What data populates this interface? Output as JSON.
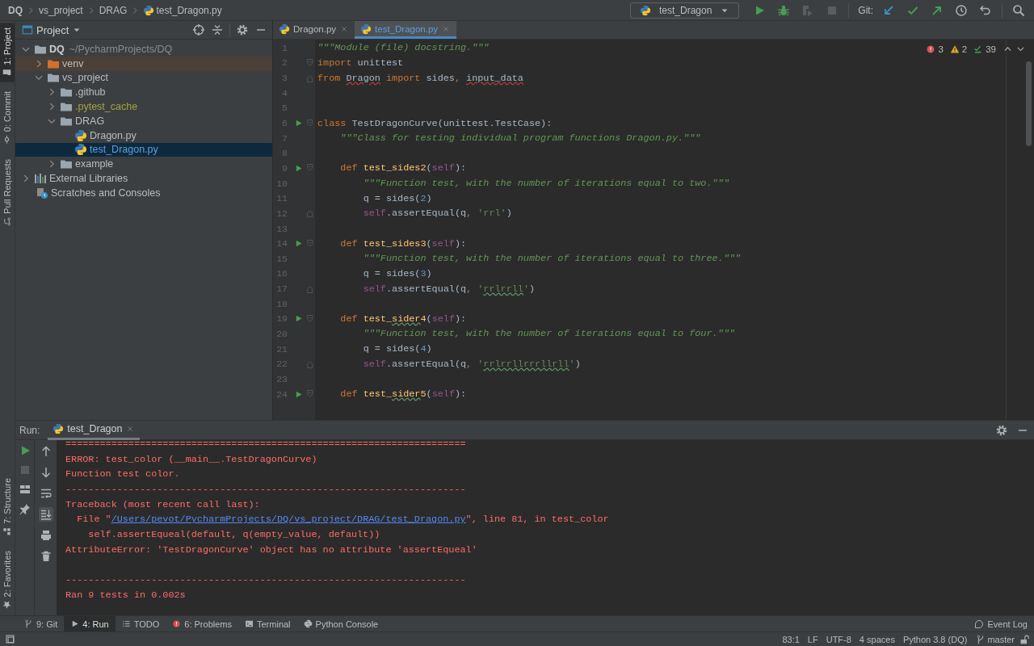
{
  "breadcrumbs": [
    {
      "label": "DQ",
      "kind": "root"
    },
    {
      "label": "vs_project",
      "kind": "folder"
    },
    {
      "label": "DRAG",
      "kind": "folder"
    },
    {
      "label": "test_Dragon.py",
      "kind": "python-file"
    }
  ],
  "toolbar": {
    "run_config": "test_Dragon",
    "actions": [
      {
        "kind": "run",
        "disabled": false
      },
      {
        "kind": "debug",
        "disabled": false
      },
      {
        "kind": "coverage",
        "disabled": true
      },
      {
        "kind": "stop",
        "disabled": true
      }
    ],
    "git_label": "Git:",
    "git_actions": [
      {
        "kind": "update"
      },
      {
        "kind": "commit"
      },
      {
        "kind": "push"
      },
      {
        "kind": "history"
      },
      {
        "kind": "rollback"
      }
    ]
  },
  "left_stripe": {
    "top": [
      {
        "label": "1: Project",
        "kind": "project",
        "selected": true
      },
      {
        "label": "0: Commit",
        "kind": "commit",
        "selected": false
      },
      {
        "label": "Pull Requests",
        "kind": "pull-request",
        "selected": false
      }
    ],
    "bottom": [
      {
        "label": "7: Structure",
        "kind": "structure",
        "selected": false
      },
      {
        "label": "2: Favorites",
        "kind": "favorites",
        "selected": false
      }
    ]
  },
  "project_panel": {
    "title": "Project",
    "tree": [
      {
        "label": "DQ",
        "detail": "~/PycharmProjects/DQ",
        "kind": "root",
        "expanded": true,
        "selected": false,
        "children": [
          {
            "label": "venv",
            "kind": "excluded-folder",
            "expanded": false,
            "selected": false
          },
          {
            "label": "vs_project",
            "kind": "folder",
            "expanded": true,
            "selected": false,
            "children": [
              {
                "label": ".github",
                "kind": "folder",
                "expanded": false,
                "selected": false
              },
              {
                "label": ".pytest_cache",
                "kind": "ignored-folder",
                "expanded": false,
                "selected": false
              },
              {
                "label": "DRAG",
                "kind": "folder",
                "expanded": true,
                "selected": false,
                "children": [
                  {
                    "label": "Dragon.py",
                    "kind": "python-file",
                    "selected": false
                  },
                  {
                    "label": "test_Dragon.py",
                    "kind": "python-file",
                    "selected": true
                  }
                ]
              },
              {
                "label": "example",
                "kind": "folder",
                "expanded": false,
                "selected": false
              }
            ]
          }
        ]
      },
      {
        "label": "External Libraries",
        "kind": "libraries",
        "expanded": false,
        "selected": false
      },
      {
        "label": "Scratches and Consoles",
        "kind": "scratches",
        "selected": false
      }
    ]
  },
  "editor": {
    "tabs": [
      {
        "label": "Dragon.py",
        "selected": false
      },
      {
        "label": "test_Dragon.py",
        "selected": true
      }
    ],
    "inspections": {
      "errors": "3",
      "warnings": "2",
      "passed": "39"
    },
    "lines": [
      {
        "number": "1",
        "tokens": [
          {
            "kind": "doc",
            "text": "\"\"\"Module (file) docstring.\"\"\""
          }
        ]
      },
      {
        "number": "2",
        "fold_start": true,
        "tokens": [
          {
            "kind": "kw",
            "text": "import"
          },
          {
            "kind": "plain",
            "text": " unittest"
          }
        ]
      },
      {
        "number": "3",
        "fold_end": true,
        "tokens": [
          {
            "kind": "kw",
            "text": "from "
          },
          {
            "kind": "plain",
            "text": "Dragon",
            "error": true
          },
          {
            "kind": "kw",
            "text": " import"
          },
          {
            "kind": "plain",
            "text": " sides"
          },
          {
            "kind": "kw",
            "text": ", "
          },
          {
            "kind": "plain",
            "text": "input_data",
            "error": true
          }
        ]
      },
      {
        "number": "4"
      },
      {
        "number": "5"
      },
      {
        "number": "6",
        "run": true,
        "fold_start": true,
        "tokens": [
          {
            "kind": "kw",
            "text": "class"
          },
          {
            "kind": "plain",
            "text": " TestDragonCurve(unittest.TestCase):"
          }
        ]
      },
      {
        "number": "7",
        "tokens": [
          {
            "kind": "doc",
            "text": "    \"\"\"Class for testing individual program functions Dragon.py.\"\"\""
          }
        ]
      },
      {
        "number": "8"
      },
      {
        "number": "9",
        "run": true,
        "fold_start": true,
        "tokens": [
          {
            "kind": "kw",
            "text": "    def "
          },
          {
            "kind": "fn",
            "text": "test_sides2"
          },
          {
            "kind": "plain",
            "text": "("
          },
          {
            "kind": "self",
            "text": "self"
          },
          {
            "kind": "plain",
            "text": "):"
          }
        ]
      },
      {
        "number": "10",
        "tokens": [
          {
            "kind": "doc",
            "text": "        \"\"\"Function test, with the number of iterations equal to two.\"\"\""
          }
        ]
      },
      {
        "number": "11",
        "tokens": [
          {
            "kind": "plain",
            "text": "        q = sides("
          },
          {
            "kind": "num",
            "text": "2"
          },
          {
            "kind": "plain",
            "text": ")"
          }
        ]
      },
      {
        "number": "12",
        "fold_end": true,
        "tokens": [
          {
            "kind": "self",
            "text": "        self"
          },
          {
            "kind": "plain",
            "text": ".assertEqual(q"
          },
          {
            "kind": "kw",
            "text": ", "
          },
          {
            "kind": "str",
            "text": "'rrl'"
          },
          {
            "kind": "plain",
            "text": ")"
          }
        ]
      },
      {
        "number": "13"
      },
      {
        "number": "14",
        "run": true,
        "fold_start": true,
        "tokens": [
          {
            "kind": "kw",
            "text": "    def "
          },
          {
            "kind": "fn",
            "text": "test_sides3"
          },
          {
            "kind": "plain",
            "text": "("
          },
          {
            "kind": "self",
            "text": "self"
          },
          {
            "kind": "plain",
            "text": "):"
          }
        ]
      },
      {
        "number": "15",
        "tokens": [
          {
            "kind": "doc",
            "text": "        \"\"\"Function test, with the number of iterations equal to three.\"\"\""
          }
        ]
      },
      {
        "number": "16",
        "tokens": [
          {
            "kind": "plain",
            "text": "        q = sides("
          },
          {
            "kind": "num",
            "text": "3"
          },
          {
            "kind": "plain",
            "text": ")"
          }
        ]
      },
      {
        "number": "17",
        "fold_end": true,
        "tokens": [
          {
            "kind": "self",
            "text": "        self"
          },
          {
            "kind": "plain",
            "text": ".assertEqual(q"
          },
          {
            "kind": "kw",
            "text": ", "
          },
          {
            "kind": "str",
            "text": "'"
          },
          {
            "kind": "str",
            "text": "rrlrrll",
            "typo": true
          },
          {
            "kind": "str",
            "text": "'"
          },
          {
            "kind": "plain",
            "text": ")"
          }
        ]
      },
      {
        "number": "18"
      },
      {
        "number": "19",
        "run": true,
        "fold_start": true,
        "tokens": [
          {
            "kind": "kw",
            "text": "    def "
          },
          {
            "kind": "fn",
            "text": "test_"
          },
          {
            "kind": "fn",
            "text": "sider",
            "typo": true
          },
          {
            "kind": "fn",
            "text": "4"
          },
          {
            "kind": "plain",
            "text": "("
          },
          {
            "kind": "self",
            "text": "self"
          },
          {
            "kind": "plain",
            "text": "):"
          }
        ]
      },
      {
        "number": "20",
        "tokens": [
          {
            "kind": "doc",
            "text": "        \"\"\"Function test, with the number of iterations equal to four.\"\"\""
          }
        ]
      },
      {
        "number": "21",
        "tokens": [
          {
            "kind": "plain",
            "text": "        q = sides("
          },
          {
            "kind": "num",
            "text": "4"
          },
          {
            "kind": "plain",
            "text": ")"
          }
        ]
      },
      {
        "number": "22",
        "fold_end": true,
        "tokens": [
          {
            "kind": "self",
            "text": "        self"
          },
          {
            "kind": "plain",
            "text": ".assertEqual(q"
          },
          {
            "kind": "kw",
            "text": ", "
          },
          {
            "kind": "str",
            "text": "'"
          },
          {
            "kind": "str",
            "text": "rrlrrllrrrllrll",
            "typo": true
          },
          {
            "kind": "str",
            "text": "'"
          },
          {
            "kind": "plain",
            "text": ")"
          }
        ]
      },
      {
        "number": "23"
      },
      {
        "number": "24",
        "run": true,
        "fold_start": true,
        "tokens": [
          {
            "kind": "kw",
            "text": "    def "
          },
          {
            "kind": "fn",
            "text": "test_"
          },
          {
            "kind": "fn",
            "text": "sider",
            "typo": true
          },
          {
            "kind": "fn",
            "text": "5"
          },
          {
            "kind": "plain",
            "text": "("
          },
          {
            "kind": "self",
            "text": "self"
          },
          {
            "kind": "plain",
            "text": "):"
          }
        ]
      }
    ]
  },
  "run_panel": {
    "label": "Run:",
    "tab": "test_Dragon",
    "left_tools": [
      {
        "kind": "rerun",
        "disabled": false
      },
      {
        "kind": "stop",
        "disabled": true
      },
      {
        "kind": "layout"
      },
      {
        "kind": "pin"
      }
    ],
    "tools": [
      {
        "kind": "up"
      },
      {
        "kind": "down"
      },
      {
        "kind": "wrap",
        "on": false
      },
      {
        "kind": "scroll-end",
        "on": true
      },
      {
        "kind": "print"
      },
      {
        "kind": "delete"
      }
    ],
    "output": [
      {
        "kind": "rule",
        "text": "======================================================================"
      },
      {
        "kind": "text",
        "text": "ERROR: test_color (__main__.TestDragonCurve)"
      },
      {
        "kind": "text",
        "text": "Function test color."
      },
      {
        "kind": "rule",
        "text": "----------------------------------------------------------------------"
      },
      {
        "kind": "text",
        "text": "Traceback (most recent call last):"
      },
      {
        "kind": "link-line",
        "before": "  File \"",
        "link": "/Users/pevot/PycharmProjects/DQ/vs_project/DRAG/test_Dragon.py",
        "after": "\", line 81, in test_color"
      },
      {
        "kind": "text",
        "text": "    self.assertEqueal(default, q(empty_value, default))"
      },
      {
        "kind": "text",
        "text": "AttributeError: 'TestDragonCurve' object has no attribute 'assertEqueal'"
      },
      {
        "kind": "blank"
      },
      {
        "kind": "rule",
        "text": "----------------------------------------------------------------------"
      },
      {
        "kind": "text",
        "text": "Ran 9 tests in 0.002s"
      }
    ]
  },
  "tool_windows": [
    {
      "label": "9: Git",
      "kind": "git",
      "selected": false
    },
    {
      "label": "4: Run",
      "kind": "run",
      "selected": true
    },
    {
      "label": "TODO",
      "kind": "todo",
      "selected": false
    },
    {
      "label": "6: Problems",
      "kind": "problems",
      "selected": false
    },
    {
      "label": "Terminal",
      "kind": "terminal",
      "selected": false
    },
    {
      "label": "Python Console",
      "kind": "python-console",
      "selected": false
    }
  ],
  "event_log": "Event Log",
  "status_bar": {
    "items": [
      "83:1",
      "LF",
      "UTF-8",
      "4 spaces",
      "Python 3.8 (DQ)"
    ],
    "branch": "master"
  }
}
